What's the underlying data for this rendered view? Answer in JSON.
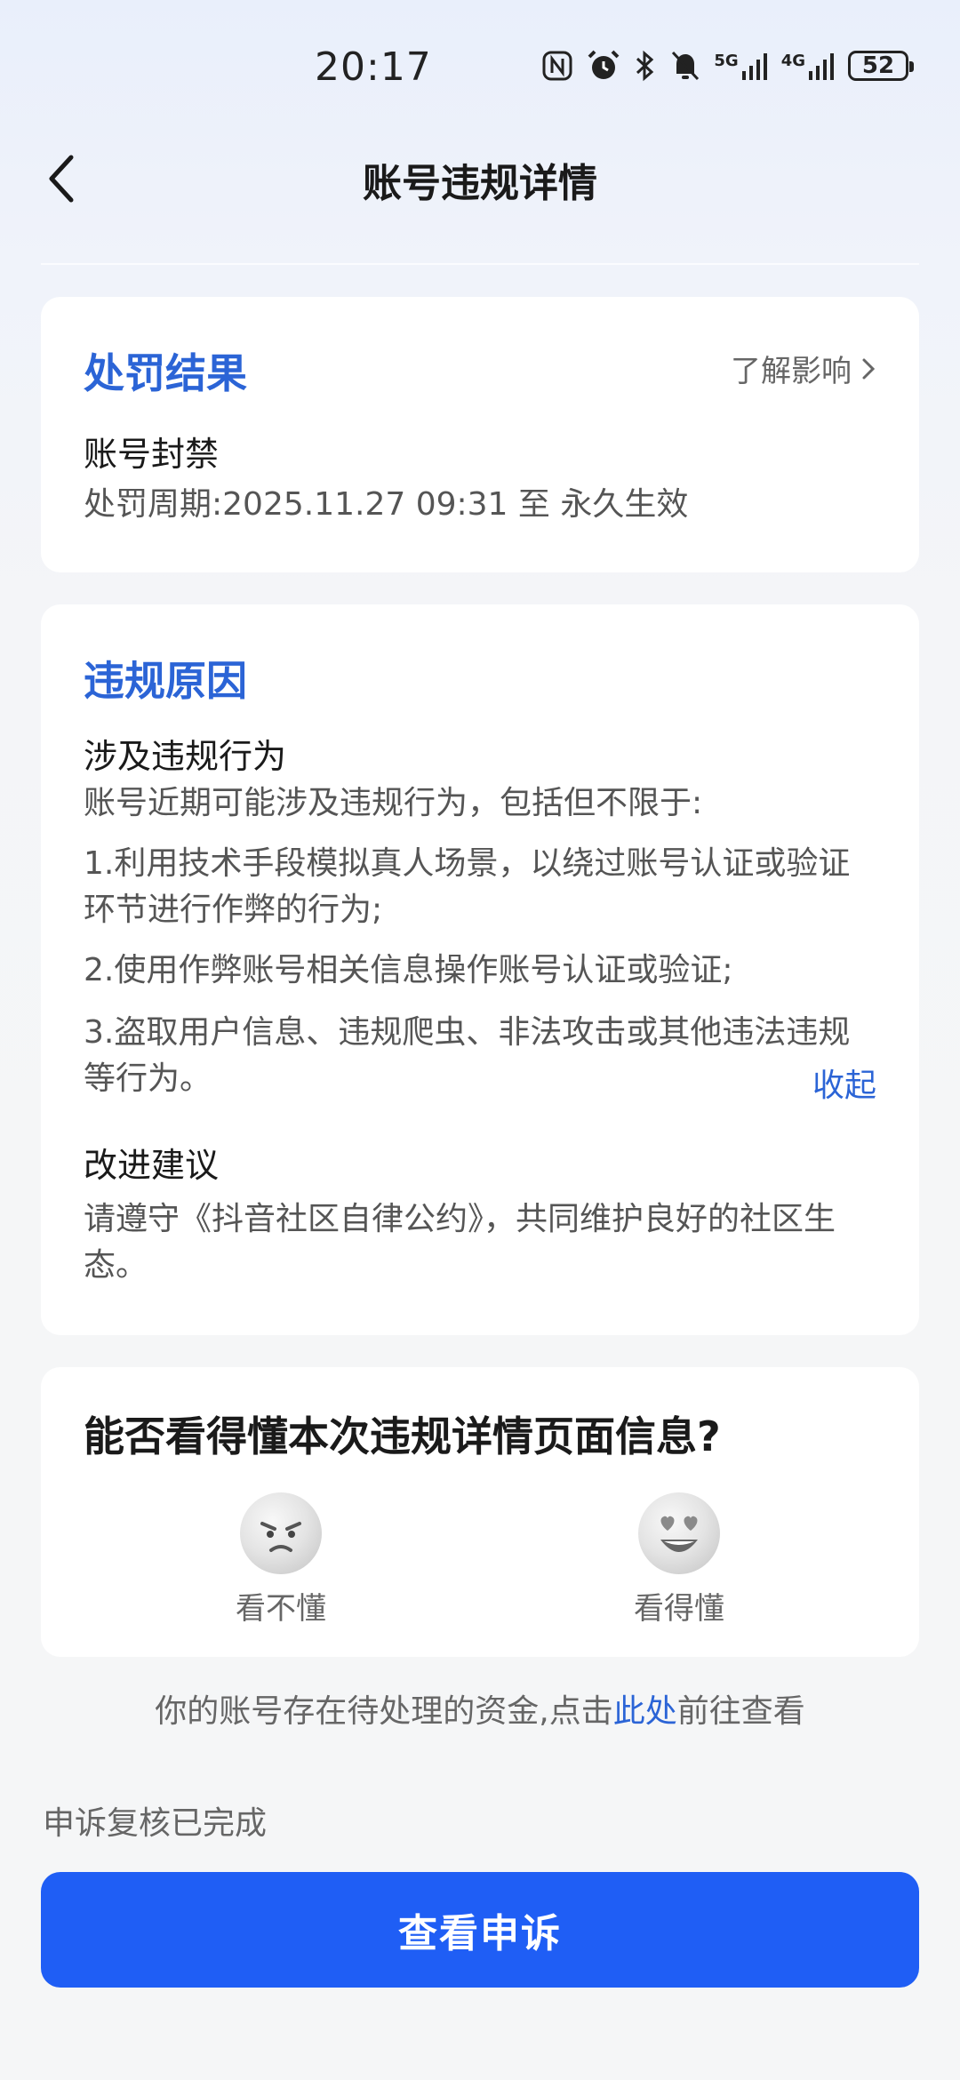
{
  "status_bar": {
    "time": "20:17",
    "network1": "5G",
    "network2": "4G",
    "battery": "52"
  },
  "nav": {
    "title": "账号违规详情"
  },
  "penalty_card": {
    "title": "处罚结果",
    "learn_more": "了解影响",
    "type": "账号封禁",
    "period": "处罚周期:2025.11.27 09:31 至 永久生效"
  },
  "reason_card": {
    "title": "违规原因",
    "behavior_title": "涉及违规行为",
    "intro": "账号近期可能涉及违规行为，包括但不限于:",
    "items": [
      "1.利用技术手段模拟真人场景，以绕过账号认证或验证环节进行作弊的行为;",
      "2.使用作弊账号相关信息操作账号认证或验证;",
      "3.盗取用户信息、违规爬虫、非法攻击或其他违法违规等行为。"
    ],
    "collapse": "收起",
    "improve_title": "改进建议",
    "improve_text": "请遵守《抖音社区自律公约》，共同维护良好的社区生态。"
  },
  "feedback_card": {
    "question": "能否看得懂本次违规详情页面信息?",
    "options": [
      {
        "label": "看不懂",
        "icon": "confused-face-icon"
      },
      {
        "label": "看得懂",
        "icon": "heart-eyes-face-icon"
      }
    ]
  },
  "funds_notice": {
    "prefix": "你的账号存在待处理的资金,点击",
    "link": "此处",
    "suffix": "前往查看"
  },
  "appeal": {
    "status": "申诉复核已完成",
    "button": "查看申诉"
  },
  "colors": {
    "accent_blue": "#2b64d6",
    "button_blue": "#1f5ef5"
  }
}
